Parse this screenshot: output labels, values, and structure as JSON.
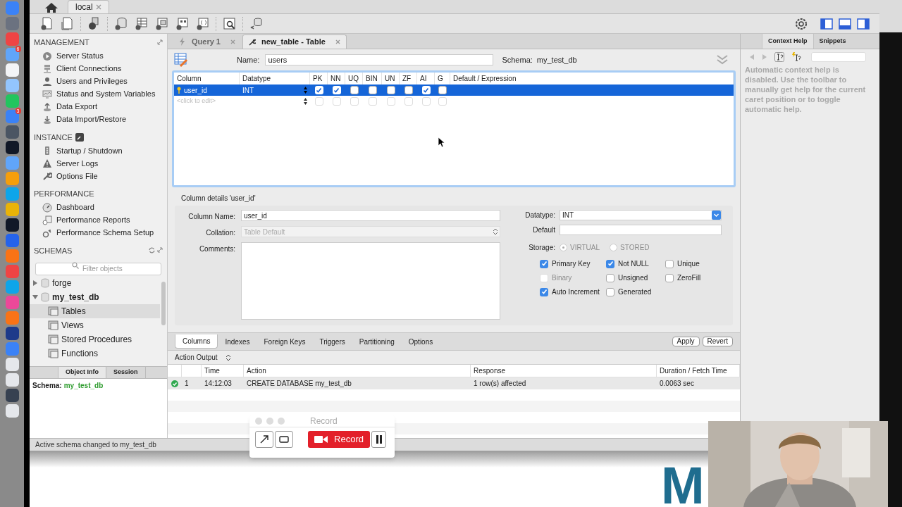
{
  "dock": [
    {
      "color": "#3b82f6"
    },
    {
      "color": "#6b7280"
    },
    {
      "color": "#ef4444"
    },
    {
      "color": "#60a5fa",
      "badge": "6"
    },
    {
      "color": "#f3f4f6"
    },
    {
      "color": "#93c5fd"
    },
    {
      "color": "#22c55e"
    },
    {
      "color": "#3b82f6",
      "badge": "3"
    },
    {
      "color": "#4b5563"
    },
    {
      "color": "#111827"
    },
    {
      "color": "#60a5fa"
    },
    {
      "color": "#f59e0b"
    },
    {
      "color": "#0ea5e9"
    },
    {
      "color": "#eab308"
    },
    {
      "color": "#111827"
    },
    {
      "color": "#2563eb"
    },
    {
      "color": "#f97316"
    },
    {
      "color": "#ef4444"
    },
    {
      "color": "#0ea5e9"
    },
    {
      "color": "#ec4899"
    },
    {
      "color": "#f97316"
    },
    {
      "color": "#1e3a8a"
    },
    {
      "color": "#3b82f6"
    },
    {
      "color": "#e5e7eb"
    },
    {
      "color": "#e5e7eb"
    },
    {
      "color": "#374151"
    },
    {
      "color": "#e5e7eb"
    }
  ],
  "connection_tabs": [
    {
      "label": "local",
      "selected": true
    }
  ],
  "sidebar": {
    "sections": [
      {
        "title": "MANAGEMENT",
        "items": [
          "Server Status",
          "Client Connections",
          "Users and Privileges",
          "Status and System Variables",
          "Data Export",
          "Data Import/Restore"
        ]
      },
      {
        "title": "INSTANCE",
        "items": [
          "Startup / Shutdown",
          "Server Logs",
          "Options File"
        ]
      },
      {
        "title": "PERFORMANCE",
        "items": [
          "Dashboard",
          "Performance Reports",
          "Performance Schema Setup"
        ]
      }
    ],
    "schemas": {
      "title": "SCHEMAS",
      "filter_placeholder": "Filter objects",
      "tree": [
        {
          "label": "forge",
          "expanded": false,
          "bold": false
        },
        {
          "label": "my_test_db",
          "expanded": true,
          "bold": true,
          "children": [
            {
              "label": "Tables",
              "selected": true
            },
            {
              "label": "Views",
              "selected": false
            },
            {
              "label": "Stored Procedures",
              "selected": false
            },
            {
              "label": "Functions",
              "selected": false
            }
          ]
        }
      ]
    },
    "info_tabs": [
      {
        "label": "Object Info",
        "selected": true
      },
      {
        "label": "Session",
        "selected": false
      }
    ],
    "info": {
      "label": "Schema:",
      "value": "my_test_db"
    }
  },
  "editor_tabs": [
    {
      "label": "Query 1",
      "selected": false
    },
    {
      "label": "new_table - Table",
      "selected": true
    }
  ],
  "table_editor": {
    "name_label": "Name:",
    "name": "users",
    "schema_label": "Schema:",
    "schema": "my_test_db",
    "columns": [
      "Column",
      "Datatype",
      "PK",
      "NN",
      "UQ",
      "BIN",
      "UN",
      "ZF",
      "AI",
      "G",
      "Default / Expression"
    ],
    "rows": [
      {
        "kind": "column",
        "name": "user_id",
        "datatype": "INT",
        "selected": true,
        "flags": [
          {
            "checked": true
          },
          {
            "checked": true
          },
          {
            "checked": false
          },
          {
            "checked": false
          },
          {
            "checked": false
          },
          {
            "checked": false
          },
          {
            "checked": true
          },
          {
            "checked": false
          }
        ]
      },
      {
        "kind": "placeholder",
        "name": "<click to edit>",
        "selected": false,
        "flags": [
          {
            "checked": false
          },
          {
            "checked": false
          },
          {
            "checked": false
          },
          {
            "checked": false
          },
          {
            "checked": false
          },
          {
            "checked": false
          },
          {
            "checked": false
          },
          {
            "checked": false
          }
        ]
      }
    ],
    "details": {
      "title": "Column details 'user_id'",
      "column_name_label": "Column Name:",
      "column_name": "user_id",
      "collation_label": "Collation:",
      "collation": "Table Default",
      "comments_label": "Comments:",
      "datatype_label": "Datatype:",
      "datatype": "INT",
      "default_label": "Default",
      "storage_label": "Storage:",
      "storage": [
        {
          "label": "VIRTUAL",
          "selected": true
        },
        {
          "label": "STORED",
          "selected": false
        }
      ],
      "options": [
        {
          "label": "Primary Key",
          "checked": true,
          "disabled": false
        },
        {
          "label": "Not NULL",
          "checked": true,
          "disabled": false
        },
        {
          "label": "Unique",
          "checked": false,
          "disabled": false
        },
        {
          "label": "Binary",
          "checked": false,
          "disabled": true
        },
        {
          "label": "Unsigned",
          "checked": false,
          "disabled": false
        },
        {
          "label": "ZeroFill",
          "checked": false,
          "disabled": false
        },
        {
          "label": "Auto Increment",
          "checked": true,
          "disabled": false
        },
        {
          "label": "Generated",
          "checked": false,
          "disabled": false
        }
      ]
    },
    "bottom_tabs": [
      {
        "label": "Columns",
        "selected": true
      },
      {
        "label": "Indexes",
        "selected": false
      },
      {
        "label": "Foreign Keys",
        "selected": false
      },
      {
        "label": "Triggers",
        "selected": false
      },
      {
        "label": "Partitioning",
        "selected": false
      },
      {
        "label": "Options",
        "selected": false
      }
    ],
    "buttons": [
      "Apply",
      "Revert"
    ]
  },
  "output": {
    "selector": "Action Output",
    "columns": [
      "Time",
      "Action",
      "Response",
      "Duration / Fetch Time"
    ],
    "rows": [
      {
        "succeeded": true,
        "index": "1",
        "time": "14:12:03",
        "action": "CREATE DATABASE my_test_db",
        "response": "1 row(s) affected",
        "duration": "0.0063 sec"
      }
    ]
  },
  "right_panel": {
    "tabs": [
      {
        "label": "Context Help",
        "selected": true
      },
      {
        "label": "Snippets",
        "selected": false
      }
    ],
    "help": "Automatic context help is disabled. Use the toolbar to manually get help for the current caret position or to toggle automatic help."
  },
  "status_bar": "Active schema changed to my_test_db",
  "recorder": {
    "title": "Record",
    "record_button": "Record"
  },
  "background_logo": "M"
}
